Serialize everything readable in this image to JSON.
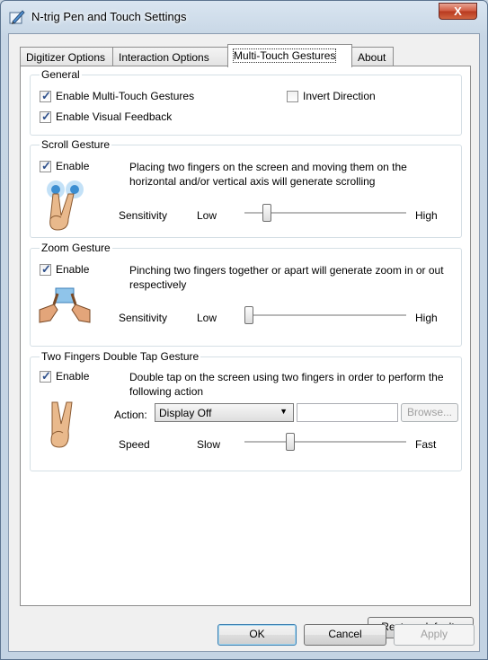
{
  "window": {
    "title": "N-trig Pen and Touch Settings",
    "close_glyph": "X"
  },
  "tabs": [
    {
      "label": "Digitizer Options"
    },
    {
      "label": "Interaction Options"
    },
    {
      "label": "Multi-Touch Gestures"
    },
    {
      "label": "About"
    }
  ],
  "active_tab": "Multi-Touch Gestures",
  "general": {
    "legend": "General",
    "enable_multitouch": {
      "label": "Enable Multi-Touch Gestures",
      "checked": true
    },
    "invert_direction": {
      "label": "Invert Direction",
      "checked": false
    },
    "enable_visual_feedback": {
      "label": "Enable Visual Feedback",
      "checked": true
    }
  },
  "scroll": {
    "legend": "Scroll Gesture",
    "enable": {
      "label": "Enable",
      "checked": true
    },
    "description": "Placing two fingers on the screen and moving them on the horizontal and/or vertical axis will generate scrolling",
    "sensitivity_label": "Sensitivity",
    "low_label": "Low",
    "high_label": "High",
    "sensitivity_value": 0.12
  },
  "zoom": {
    "legend": "Zoom Gesture",
    "enable": {
      "label": "Enable",
      "checked": true
    },
    "description": "Pinching two fingers together or apart will generate zoom in or out respectively",
    "sensitivity_label": "Sensitivity",
    "low_label": "Low",
    "high_label": "High",
    "sensitivity_value": 0.0
  },
  "double_tap": {
    "legend": "Two Fingers Double Tap Gesture",
    "enable": {
      "label": "Enable",
      "checked": true
    },
    "description": "Double tap on the screen using two fingers in order to perform the following action",
    "action_label": "Action:",
    "action_value": "Display Off",
    "action_path": "",
    "browse_label": "Browse...",
    "speed_label": "Speed",
    "slow_label": "Slow",
    "fast_label": "Fast",
    "speed_value": 0.27
  },
  "buttons": {
    "restore_defaults": "Restore defaults",
    "ok": "OK",
    "cancel": "Cancel",
    "apply": "Apply"
  },
  "icons": {
    "app": "pen-tablet-icon",
    "scroll": "two-finger-scroll-icon",
    "zoom": "two-hand-pinch-icon",
    "double_tap": "two-finger-tap-icon"
  }
}
